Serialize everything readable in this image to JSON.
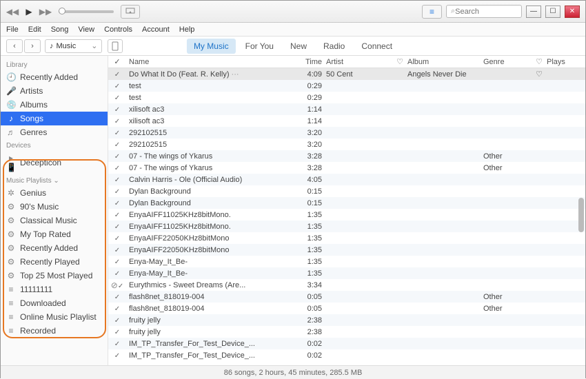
{
  "menus": [
    "File",
    "Edit",
    "Song",
    "View",
    "Controls",
    "Account",
    "Help"
  ],
  "search_placeholder": "Search",
  "source": "Music",
  "tabs": [
    {
      "label": "My Music",
      "active": true
    },
    {
      "label": "For You",
      "active": false
    },
    {
      "label": "New",
      "active": false
    },
    {
      "label": "Radio",
      "active": false
    },
    {
      "label": "Connect",
      "active": false
    }
  ],
  "sidebar": {
    "sections": [
      {
        "title": "Library",
        "items": [
          {
            "icon": "🕘",
            "label": "Recently Added",
            "sel": false
          },
          {
            "icon": "🎤",
            "label": "Artists",
            "sel": false
          },
          {
            "icon": "💿",
            "label": "Albums",
            "sel": false
          },
          {
            "icon": "♪",
            "label": "Songs",
            "sel": true
          },
          {
            "icon": "♬",
            "label": "Genres",
            "sel": false
          }
        ]
      },
      {
        "title": "Devices",
        "items": [
          {
            "icon": "▸ 📱",
            "label": "Decepticon",
            "sel": false
          }
        ]
      },
      {
        "title": "Music Playlists ⌄",
        "items": [
          {
            "icon": "✲",
            "label": "Genius",
            "sel": false
          },
          {
            "icon": "⚙",
            "label": "90's Music",
            "sel": false
          },
          {
            "icon": "⚙",
            "label": "Classical Music",
            "sel": false
          },
          {
            "icon": "⚙",
            "label": "My Top Rated",
            "sel": false
          },
          {
            "icon": "⚙",
            "label": "Recently Added",
            "sel": false
          },
          {
            "icon": "⚙",
            "label": "Recently Played",
            "sel": false
          },
          {
            "icon": "⚙",
            "label": "Top 25 Most Played",
            "sel": false
          },
          {
            "icon": "≡",
            "label": "11111111",
            "sel": false
          },
          {
            "icon": "≡",
            "label": "Downloaded",
            "sel": false
          },
          {
            "icon": "≡",
            "label": "Online Music Playlist",
            "sel": false
          },
          {
            "icon": "≡",
            "label": "Recorded",
            "sel": false
          }
        ]
      }
    ]
  },
  "columns": {
    "name": "Name",
    "time": "Time",
    "artist": "Artist",
    "album": "Album",
    "genre": "Genre",
    "plays": "Plays"
  },
  "rows": [
    {
      "warn": "",
      "name": "Do What It Do (Feat. R. Kelly)",
      "more": "···",
      "time": "4:09",
      "artist": "50 Cent",
      "loved": false,
      "album": "Angels Never Die",
      "genre": "",
      "loved2": "♡",
      "sel": true
    },
    {
      "warn": "",
      "name": "test",
      "time": "0:29",
      "artist": "",
      "album": "",
      "genre": ""
    },
    {
      "warn": "",
      "name": "test",
      "time": "0:29",
      "artist": "",
      "album": "",
      "genre": ""
    },
    {
      "warn": "",
      "name": "xilisoft ac3",
      "time": "1:14",
      "artist": "",
      "album": "",
      "genre": ""
    },
    {
      "warn": "",
      "name": "xilisoft ac3",
      "time": "1:14",
      "artist": "",
      "album": "",
      "genre": ""
    },
    {
      "warn": "",
      "name": "292102515",
      "time": "3:20",
      "artist": "",
      "album": "",
      "genre": ""
    },
    {
      "warn": "",
      "name": "292102515",
      "time": "3:20",
      "artist": "",
      "album": "",
      "genre": ""
    },
    {
      "warn": "",
      "name": "07 - The wings of Ykarus",
      "time": "3:28",
      "artist": "",
      "album": "",
      "genre": "Other"
    },
    {
      "warn": "",
      "name": "07 - The wings of Ykarus",
      "time": "3:28",
      "artist": "",
      "album": "",
      "genre": "Other"
    },
    {
      "warn": "",
      "name": "Calvin Harris - Ole (Official Audio)",
      "time": "4:05",
      "artist": "",
      "album": "",
      "genre": ""
    },
    {
      "warn": "",
      "name": "Dylan Background",
      "time": "0:15",
      "artist": "",
      "album": "",
      "genre": ""
    },
    {
      "warn": "",
      "name": "Dylan Background",
      "time": "0:15",
      "artist": "",
      "album": "",
      "genre": ""
    },
    {
      "warn": "",
      "name": "EnyaAIFF11025KHz8bitMono.",
      "time": "1:35",
      "artist": "",
      "album": "",
      "genre": ""
    },
    {
      "warn": "",
      "name": "EnyaAIFF11025KHz8bitMono.",
      "time": "1:35",
      "artist": "",
      "album": "",
      "genre": ""
    },
    {
      "warn": "",
      "name": "EnyaAIFF22050KHz8bitMono",
      "time": "1:35",
      "artist": "",
      "album": "",
      "genre": ""
    },
    {
      "warn": "",
      "name": "EnyaAIFF22050KHz8bitMono",
      "time": "1:35",
      "artist": "",
      "album": "",
      "genre": ""
    },
    {
      "warn": "",
      "name": "Enya-May_It_Be-",
      "time": "1:35",
      "artist": "",
      "album": "",
      "genre": ""
    },
    {
      "warn": "",
      "name": "Enya-May_It_Be-",
      "time": "1:35",
      "artist": "",
      "album": "",
      "genre": ""
    },
    {
      "warn": "⊘",
      "name": "Eurythmics - Sweet Dreams (Are...",
      "time": "3:34",
      "artist": "",
      "album": "",
      "genre": ""
    },
    {
      "warn": "",
      "name": "flash8net_818019-004",
      "time": "0:05",
      "artist": "",
      "album": "",
      "genre": "Other"
    },
    {
      "warn": "",
      "name": "flash8net_818019-004",
      "time": "0:05",
      "artist": "",
      "album": "",
      "genre": "Other"
    },
    {
      "warn": "",
      "name": "fruity jelly",
      "time": "2:38",
      "artist": "",
      "album": "",
      "genre": ""
    },
    {
      "warn": "",
      "name": "fruity jelly",
      "time": "2:38",
      "artist": "",
      "album": "",
      "genre": ""
    },
    {
      "warn": "",
      "name": "IM_TP_Transfer_For_Test_Device_...",
      "time": "0:02",
      "artist": "",
      "album": "",
      "genre": ""
    },
    {
      "warn": "",
      "name": "IM_TP_Transfer_For_Test_Device_...",
      "time": "0:02",
      "artist": "",
      "album": "",
      "genre": ""
    }
  ],
  "status": "86 songs, 2 hours, 45 minutes, 285.5 MB"
}
